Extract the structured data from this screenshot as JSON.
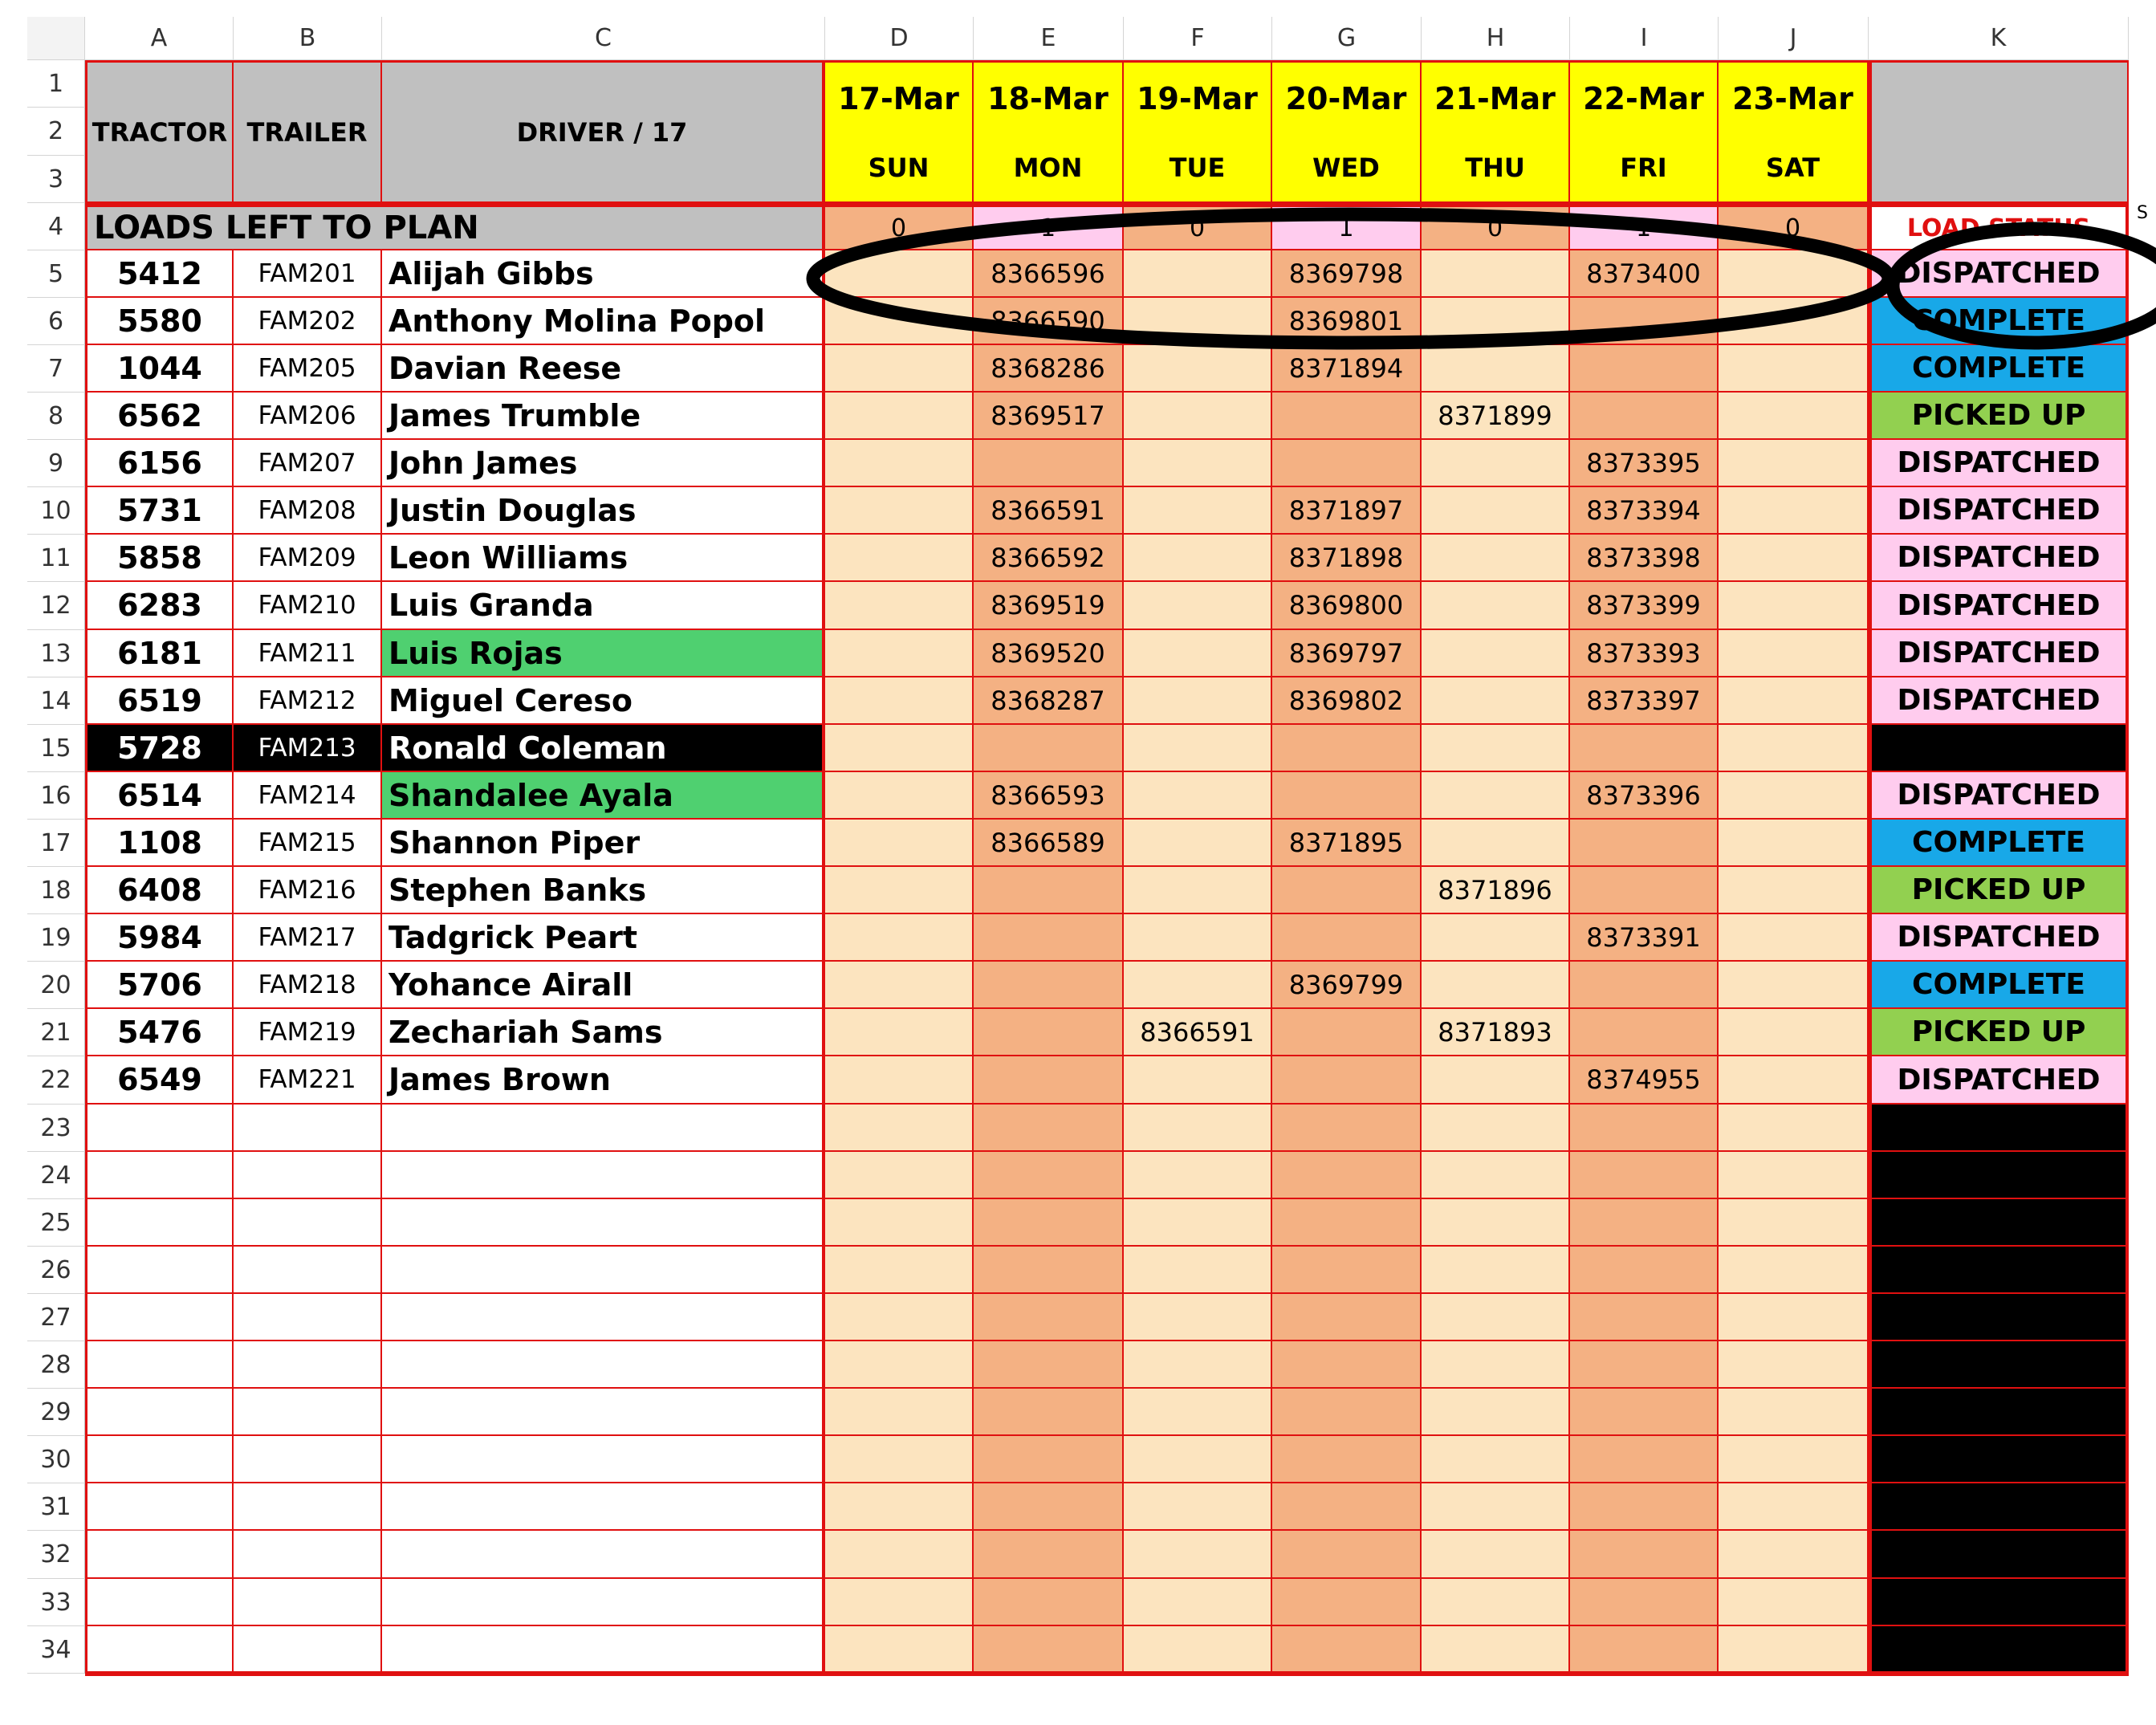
{
  "columns": [
    "A",
    "B",
    "C",
    "D",
    "E",
    "F",
    "G",
    "H",
    "I",
    "J",
    "K"
  ],
  "header": {
    "tractor": "TRACTOR",
    "trailer": "TRAILER",
    "driver": "DRIVER / 17",
    "dates": [
      {
        "date": "17-Mar",
        "day": "SUN"
      },
      {
        "date": "18-Mar",
        "day": "MON"
      },
      {
        "date": "19-Mar",
        "day": "TUE"
      },
      {
        "date": "20-Mar",
        "day": "WED"
      },
      {
        "date": "21-Mar",
        "day": "THU"
      },
      {
        "date": "22-Mar",
        "day": "FRI"
      },
      {
        "date": "23-Mar",
        "day": "SAT"
      }
    ]
  },
  "loads_row": {
    "label": "LOADS LEFT TO PLAN",
    "counts": [
      "0",
      "1",
      "0",
      "1",
      "0",
      "1",
      "0"
    ],
    "status_header": "LOAD STATUS",
    "next_col_fragment": "S"
  },
  "rows": [
    {
      "tractor": "5412",
      "trailer": "FAM201",
      "driver": "Alijah Gibbs",
      "loads": [
        "",
        "8366596",
        "",
        "8369798",
        "",
        "8373400",
        ""
      ],
      "status": "DISPATCHED"
    },
    {
      "tractor": "5580",
      "trailer": "FAM202",
      "driver": "Anthony Molina Popol",
      "loads": [
        "",
        "8366590",
        "",
        "8369801",
        "",
        "",
        ""
      ],
      "status": "COMPLETE"
    },
    {
      "tractor": "1044",
      "trailer": "FAM205",
      "driver": "Davian Reese",
      "loads": [
        "",
        "8368286",
        "",
        "8371894",
        "",
        "",
        ""
      ],
      "status": "COMPLETE"
    },
    {
      "tractor": "6562",
      "trailer": "FAM206",
      "driver": "James Trumble",
      "loads": [
        "",
        "8369517",
        "",
        "",
        "8371899",
        "",
        ""
      ],
      "status": "PICKED UP"
    },
    {
      "tractor": "6156",
      "trailer": "FAM207",
      "driver": "John James",
      "loads": [
        "",
        "",
        "",
        "",
        "",
        "8373395",
        ""
      ],
      "status": "DISPATCHED"
    },
    {
      "tractor": "5731",
      "trailer": "FAM208",
      "driver": "Justin Douglas",
      "loads": [
        "",
        "8366591",
        "",
        "8371897",
        "",
        "8373394",
        ""
      ],
      "status": "DISPATCHED"
    },
    {
      "tractor": "5858",
      "trailer": "FAM209",
      "driver": "Leon Williams",
      "loads": [
        "",
        "8366592",
        "",
        "8371898",
        "",
        "8373398",
        ""
      ],
      "status": "DISPATCHED"
    },
    {
      "tractor": "6283",
      "trailer": "FAM210",
      "driver": "Luis Granda",
      "loads": [
        "",
        "8369519",
        "",
        "8369800",
        "",
        "8373399",
        ""
      ],
      "status": "DISPATCHED"
    },
    {
      "tractor": "6181",
      "trailer": "FAM211",
      "driver": "Luis Rojas",
      "loads": [
        "",
        "8369520",
        "",
        "8369797",
        "",
        "8373393",
        ""
      ],
      "status": "DISPATCHED"
    },
    {
      "tractor": "6519",
      "trailer": "FAM212",
      "driver": "Miguel Cereso",
      "loads": [
        "",
        "8368287",
        "",
        "8369802",
        "",
        "8373397",
        ""
      ],
      "status": "DISPATCHED"
    },
    {
      "tractor": "5728",
      "trailer": "FAM213",
      "driver": "Ronald Coleman",
      "loads": [
        "",
        "",
        "",
        "",
        "",
        "",
        ""
      ],
      "status": ""
    },
    {
      "tractor": "6514",
      "trailer": "FAM214",
      "driver": "Shandalee Ayala",
      "loads": [
        "",
        "8366593",
        "",
        "",
        "",
        "8373396",
        ""
      ],
      "status": "DISPATCHED"
    },
    {
      "tractor": "1108",
      "trailer": "FAM215",
      "driver": "Shannon Piper",
      "loads": [
        "",
        "8366589",
        "",
        "8371895",
        "",
        "",
        ""
      ],
      "status": "COMPLETE"
    },
    {
      "tractor": "6408",
      "trailer": "FAM216",
      "driver": "Stephen Banks",
      "loads": [
        "",
        "",
        "",
        "",
        "8371896",
        "",
        ""
      ],
      "status": "PICKED UP"
    },
    {
      "tractor": "5984",
      "trailer": "FAM217",
      "driver": "Tadgrick Peart",
      "loads": [
        "",
        "",
        "",
        "",
        "",
        "8373391",
        ""
      ],
      "status": "DISPATCHED"
    },
    {
      "tractor": "5706",
      "trailer": "FAM218",
      "driver": "Yohance Airall",
      "loads": [
        "",
        "",
        "",
        "8369799",
        "",
        "",
        ""
      ],
      "status": "COMPLETE"
    },
    {
      "tractor": "5476",
      "trailer": "FAM219",
      "driver": "Zechariah Sams",
      "loads": [
        "",
        "",
        "8366591",
        "",
        "8371893",
        "",
        ""
      ],
      "status": "PICKED UP"
    },
    {
      "tractor": "6549",
      "trailer": "FAM221",
      "driver": "James Brown",
      "loads": [
        "",
        "",
        "",
        "",
        "",
        "8374955",
        ""
      ],
      "status": "DISPATCHED"
    }
  ],
  "empty_rows_count": 12,
  "highlight_rows": {
    "black": [
      10
    ],
    "green_driver": [
      8,
      11
    ]
  },
  "colors": {
    "grey_header": "#c0c0c0",
    "yellow_header": "#ffff00",
    "cream": "#fce4bf",
    "salmon": "#f4b183",
    "pink": "#ffccee",
    "status_dispatched": "#ffccee",
    "status_complete": "#18a8e8",
    "status_picked_up": "#92d050",
    "driver_green": "#4fd070",
    "black": "#000000",
    "red_border": "#e01010",
    "annotation_ink": "#000000"
  },
  "annotation": {
    "shape": "hand-drawn ellipses",
    "targets": [
      "row 5 load cells D–J",
      "row 5 status cell K"
    ]
  }
}
